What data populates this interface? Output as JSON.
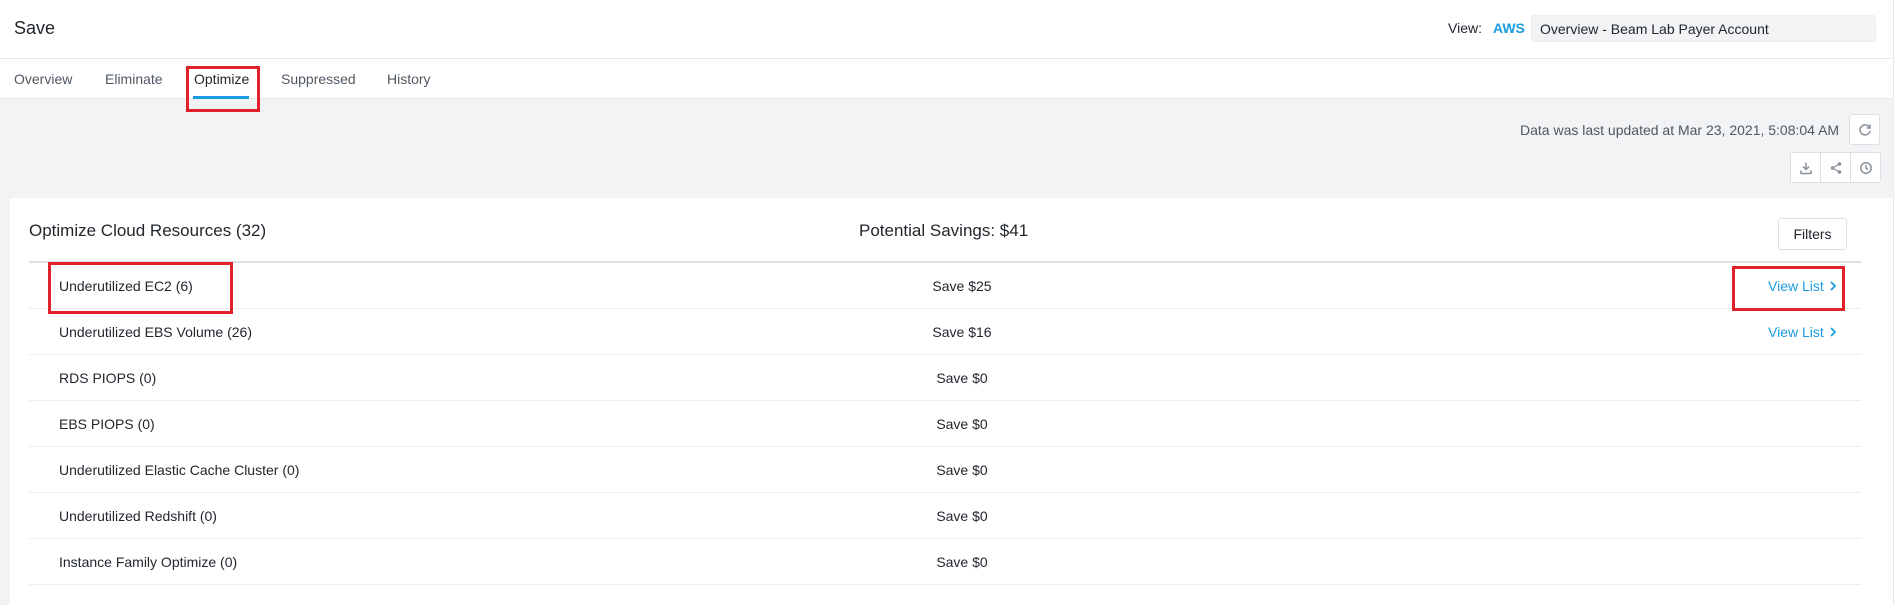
{
  "header": {
    "title": "Save",
    "view_label": "View:",
    "cloud": "AWS",
    "account": "Overview - Beam Lab Payer Account"
  },
  "tabs": [
    {
      "label": "Overview"
    },
    {
      "label": "Eliminate"
    },
    {
      "label": "Optimize",
      "active": true
    },
    {
      "label": "Suppressed"
    },
    {
      "label": "History"
    }
  ],
  "status": {
    "last_updated": "Data was last updated at Mar 23, 2021, 5:08:04 AM"
  },
  "toolbar_icons": [
    "refresh-icon",
    "download-icon",
    "share-icon",
    "schedule-icon"
  ],
  "card": {
    "title": "Optimize Cloud Resources (32)",
    "potential_savings": "Potential Savings: $41",
    "filters_label": "Filters"
  },
  "rows": [
    {
      "name": "Underutilized EC2 (6)",
      "save": "Save $25",
      "link": "View List"
    },
    {
      "name": "Underutilized EBS Volume (26)",
      "save": "Save $16",
      "link": "View List"
    },
    {
      "name": "RDS PIOPS (0)",
      "save": "Save $0",
      "link": ""
    },
    {
      "name": "EBS PIOPS (0)",
      "save": "Save $0",
      "link": ""
    },
    {
      "name": "Underutilized Elastic Cache Cluster (0)",
      "save": "Save $0",
      "link": ""
    },
    {
      "name": "Underutilized Redshift (0)",
      "save": "Save $0",
      "link": ""
    },
    {
      "name": "Instance Family Optimize (0)",
      "save": "Save $0",
      "link": ""
    }
  ],
  "colors": {
    "accent": "#1b9be0",
    "highlight": "#e2202c",
    "background": "#f2f3f5"
  }
}
